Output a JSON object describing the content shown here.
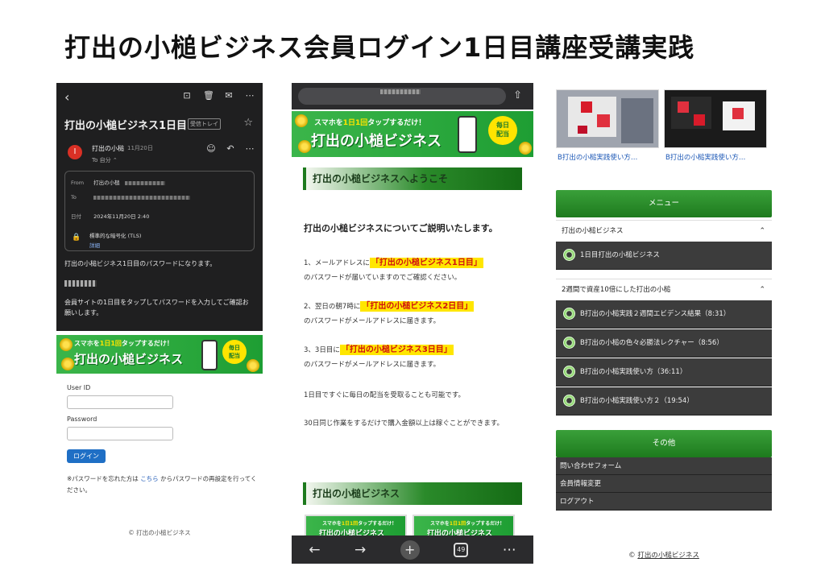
{
  "page_title": "打出の小槌ビジネス会員ログイン1日目講座受講実践",
  "left": {
    "email": {
      "subject": "打出の小槌ビジネス1日目",
      "inbox_badge": "受信トレイ",
      "avatar_letter": "I",
      "sender": "打出の小槌",
      "date": "11月20日",
      "to_me": "To 自分",
      "from_label": "From",
      "from_value": "打出の小槌",
      "to_label": "To",
      "date_label": "日付",
      "date_value": "2024年11月20日 2:40",
      "encryption": "標準的な暗号化 (TLS)",
      "details_link": "詳細",
      "body_line1": "打出の小槌ビジネス1日目のパスワードになります。",
      "body_line2": "会員サイトの1日目をタップしてパスワードを入力してご確認お願いします。"
    },
    "login": {
      "userid_label": "User ID",
      "password_label": "Password",
      "login_button": "ログイン",
      "forgot_before": "※パスワードを忘れた方は",
      "forgot_link": "こちら",
      "forgot_after": "からパスワードの再設定を行ってください。"
    },
    "footer": "© 打出の小槌ビジネス"
  },
  "banner": {
    "sub_pre": "スマホを",
    "sub_hl": "1日1回",
    "sub_post": "タップするだけ！",
    "main": "打出の小槌ビジネス",
    "badge_line1": "毎日",
    "badge_line2": "配当"
  },
  "middle": {
    "welcome_heading": "打出の小槌ビジネスへようこそ",
    "intro_title": "打出の小槌ビジネスについてご説明いたします。",
    "step1_pre": "1、メールアドレスに",
    "step1_hl": "「打出の小槌ビジネス1日目」",
    "step1_post": "のパスワードが届いていますのでご確認ください。",
    "step2_pre": "2、翌日の朝7時に",
    "step2_hl": "「打出の小槌ビジネス2日目」",
    "step2_post": "のパスワードがメールアドレスに届きます。",
    "step3_pre": "3、3日目に",
    "step3_hl": "「打出の小槌ビジネス3日目」",
    "step3_post": "のパスワードがメールアドレスに届きます。",
    "note1": "1日目ですぐに毎日の配当を受取ることも可能です。",
    "note2": "30日同じ作業をするだけで購入金額以上は稼ぐことができます。",
    "section2_heading": "打出の小槌ビジネス",
    "tabs_count": "49"
  },
  "right": {
    "thumb1_caption": "B打出の小槌実践使い方…",
    "thumb2_caption": "B打出の小槌実践使い方…",
    "menu_heading": "メニュー",
    "group1_title": "打出の小槌ビジネス",
    "group1_items": [
      "1日目打出の小槌ビジネス"
    ],
    "group2_title": "2週間で資産10倍にした打出の小槌",
    "group2_items": [
      "B打出の小槌実践２週間エビデンス結果（8:31）",
      "B打出の小槌の色々必勝法レクチャー（8:56）",
      "B打出の小槌実践使い方（36:11）",
      "B打出の小槌実践使い方２（19:54）"
    ],
    "other_heading": "その他",
    "other_items": [
      "問い合わせフォーム",
      "会員情報変更",
      "ログアウト"
    ],
    "footer": "打出の小槌ビジネス"
  }
}
